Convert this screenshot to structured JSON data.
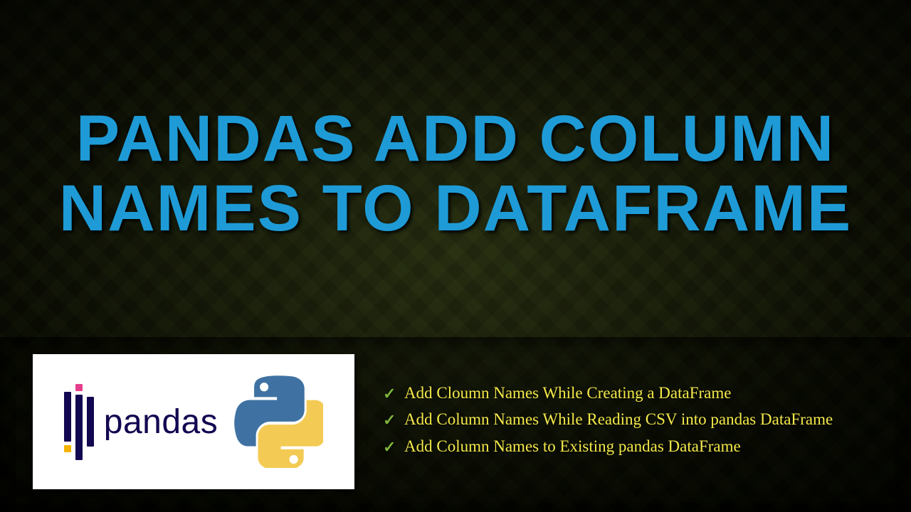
{
  "title": "PANDAS ADD COLUMN NAMES TO DATAFRAME",
  "logo": {
    "word": "pandas"
  },
  "bullets": [
    "Add Cloumn Names While Creating a DataFrame",
    "Add Column Names While Reading CSV into pandas DataFrame",
    "Add Column Names to Existing pandas DataFrame"
  ],
  "colors": {
    "title": "#1e9bd6",
    "bullet_text": "#f4e94b",
    "check": "#7db33a"
  }
}
